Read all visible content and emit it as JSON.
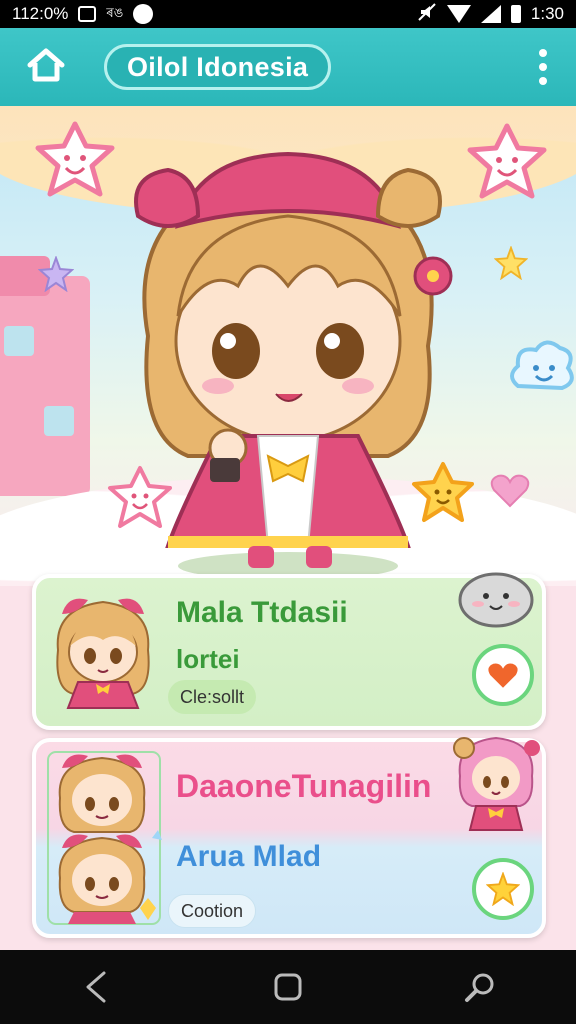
{
  "status_bar": {
    "time_left": "112:0%",
    "time_right": "1:30",
    "icons": [
      "notification-box-icon",
      "carrier-icon",
      "circle-app-icon",
      "mute-icon",
      "wifi-icon",
      "signal-icon",
      "battery-icon"
    ],
    "carrier_text": "ৰঙ"
  },
  "header": {
    "title": "Oilol Idonesia",
    "icons": [
      "home-icon",
      "more-vertical-icon"
    ],
    "colors": {
      "bar": "#3fc6c8",
      "pill": "#29b2b3"
    }
  },
  "hero": {
    "icons": [
      "smiling-star-icon",
      "smiling-cloud-icon",
      "star-icon",
      "heart-icon",
      "chibi-girl-illustration"
    ]
  },
  "cards": [
    {
      "title": "Mala Ttdasii",
      "subtitle": "lortei",
      "tag": "Cle:sollt",
      "action_icon": "heart-icon",
      "decor_icon": "seal-mascot-icon",
      "colors": {
        "background": "#dcf3cf",
        "text": "#3a9a3a",
        "accent": "#6bd57e"
      }
    },
    {
      "title": "DaaoneTunagilin",
      "subtitle": "Arua Mlad",
      "tag": "Cootion",
      "action_icon": "star-icon",
      "decor_icon": "pink-chibi-avatar",
      "colors": {
        "background_top": "#fbdbe6",
        "background_bottom": "#cfe7f7",
        "title": "#ea4f8b",
        "subtitle": "#3f8fda"
      }
    }
  ],
  "nav_bar": {
    "icons": [
      "back-icon",
      "home-square-icon",
      "search-icon"
    ]
  }
}
